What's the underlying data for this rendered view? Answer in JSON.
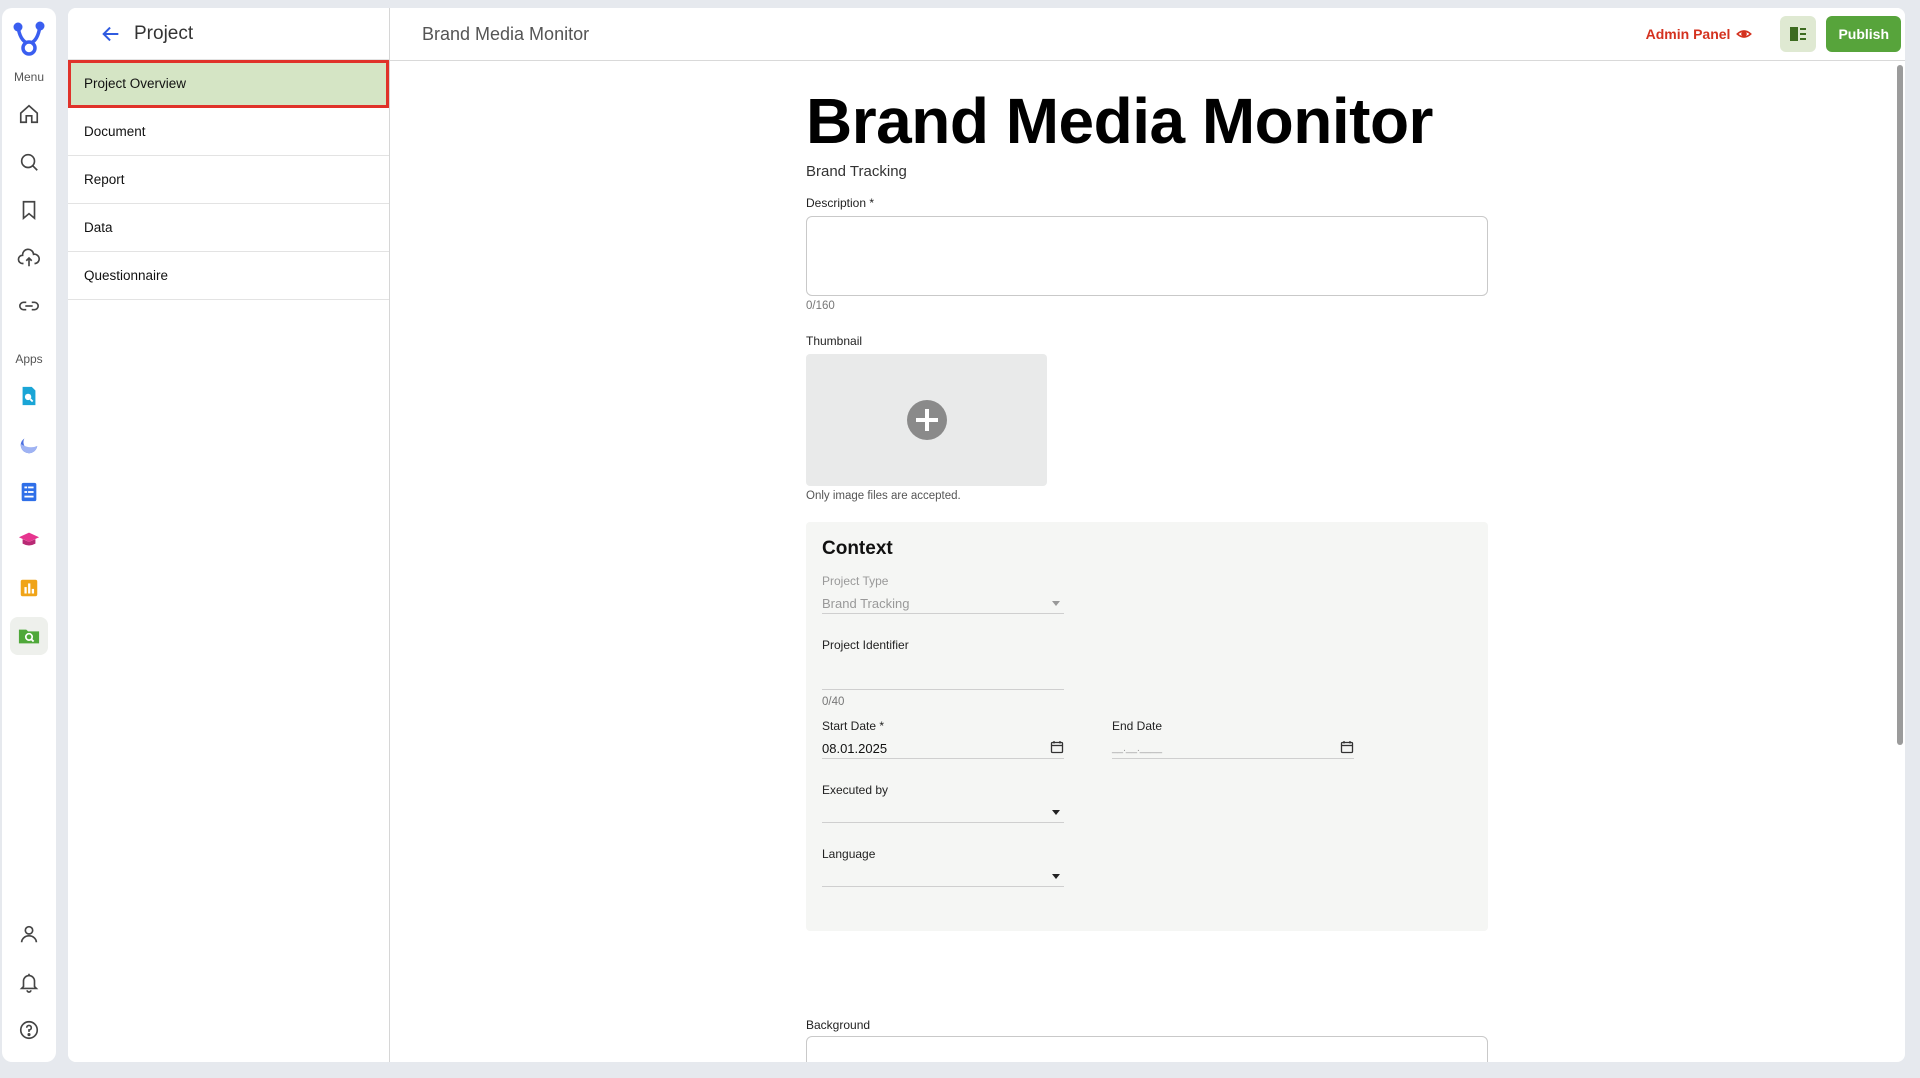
{
  "rail": {
    "menu_label": "Menu",
    "apps_label": "Apps",
    "menu_icons": [
      "home-icon",
      "search-icon",
      "bookmark-icon",
      "cloud-upload-icon",
      "link-icon"
    ],
    "app_icons": [
      "doc-search-app-icon",
      "moon-app-icon",
      "form-app-icon",
      "graduation-app-icon",
      "bar-chart-app-icon",
      "folder-search-app-icon"
    ],
    "bottom_icons": [
      "user-icon",
      "bell-icon",
      "help-icon"
    ]
  },
  "subnav": {
    "back_label": "Project",
    "items": [
      "Project Overview",
      "Document",
      "Report",
      "Data",
      "Questionnaire"
    ],
    "active_index": 0
  },
  "topbar": {
    "title": "Brand Media Monitor",
    "admin_panel": "Admin Panel",
    "publish": "Publish"
  },
  "form": {
    "title": "Brand Media Monitor",
    "subtitle": "Brand Tracking",
    "description_label": "Description *",
    "description_value": "",
    "description_counter": "0/160",
    "thumbnail_label": "Thumbnail",
    "thumbnail_hint": "Only image files are accepted.",
    "context": {
      "heading": "Context",
      "project_type_label": "Project Type",
      "project_type_value": "Brand Tracking",
      "project_identifier_label": "Project Identifier",
      "project_identifier_value": "",
      "project_identifier_counter": "0/40",
      "start_date_label": "Start Date *",
      "start_date_value": "08.01.2025",
      "end_date_label": "End Date",
      "end_date_placeholder": "__.__.____",
      "executed_by_label": "Executed by",
      "executed_by_value": "",
      "language_label": "Language",
      "language_value": ""
    },
    "background_label": "Background"
  },
  "colors": {
    "accent_green": "#57a43b",
    "active_nav_bg": "#d5e5c5",
    "highlight_red": "#e0322a",
    "admin_red": "#d4321f"
  }
}
